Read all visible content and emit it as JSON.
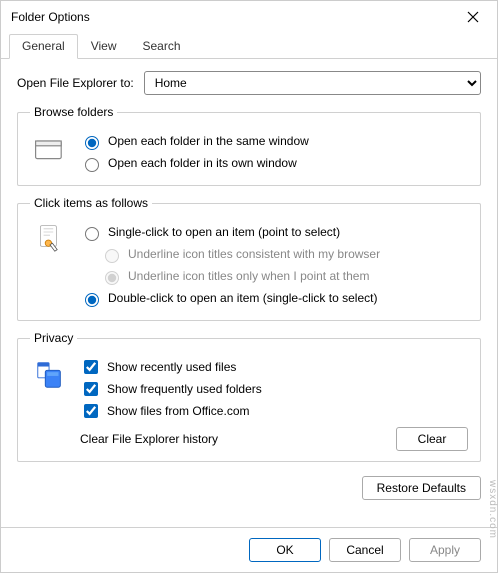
{
  "window": {
    "title": "Folder Options"
  },
  "tabs": [
    "General",
    "View",
    "Search"
  ],
  "open_explorer": {
    "label": "Open File Explorer to:",
    "value": "Home"
  },
  "browse": {
    "legend": "Browse folders",
    "opt_same": "Open each folder in the same window",
    "opt_own": "Open each folder in its own window"
  },
  "click": {
    "legend": "Click items as follows",
    "opt_single": "Single-click to open an item (point to select)",
    "opt_ul_browser": "Underline icon titles consistent with my browser",
    "opt_ul_point": "Underline icon titles only when I point at them",
    "opt_double": "Double-click to open an item (single-click to select)"
  },
  "privacy": {
    "legend": "Privacy",
    "opt_recent": "Show recently used files",
    "opt_frequent": "Show frequently used folders",
    "opt_office": "Show files from Office.com",
    "clear_label": "Clear File Explorer history",
    "clear_btn": "Clear"
  },
  "restore_defaults": "Restore Defaults",
  "buttons": {
    "ok": "OK",
    "cancel": "Cancel",
    "apply": "Apply"
  },
  "watermark": "wsxdn.com"
}
